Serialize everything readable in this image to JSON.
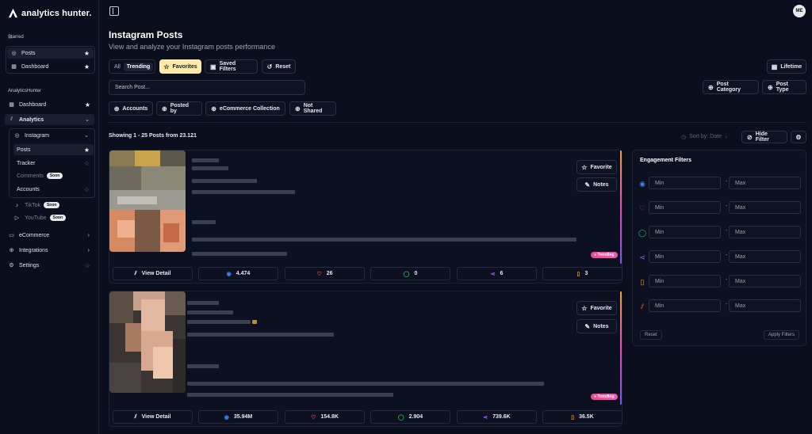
{
  "brand": {
    "name": "analytics hunter."
  },
  "sidebar": {
    "starred_label": "Starred",
    "starred": [
      {
        "label": "Posts"
      },
      {
        "label": "Dashboard"
      }
    ],
    "workspace_label": "AnalyticsHunter",
    "items": {
      "dashboard": "Dashboard",
      "analytics": "Analytics",
      "instagram": "Instagram",
      "posts": "Posts",
      "tracker": "Tracker",
      "comments": "Comments",
      "accounts": "Accounts",
      "tiktok": "TikTok",
      "youtube": "YouTube",
      "ecommerce": "eCommerce",
      "integrations": "Integrations",
      "settings": "Settings"
    },
    "soon_badge": "Soon"
  },
  "user": {
    "initials": "ME"
  },
  "page": {
    "title": "Instagram Posts",
    "subtitle": "View and analyze your Instagram posts performance"
  },
  "toolbar": {
    "seg_all": "All",
    "seg_trending": "Trending",
    "favorites": "Favorites",
    "saved_filters": "Saved Filters",
    "reset": "Reset",
    "lifetime": "Lifetime",
    "search_placeholder": "Search Post...",
    "post_category": "Post Category",
    "post_type": "Post Type",
    "accounts": "Accounts",
    "posted_by": "Posted by",
    "ecommerce_collection": "eCommerce Collection",
    "not_shared": "Not Shared"
  },
  "results": {
    "showing": "Showing 1 - 25 Posts from 23.121",
    "sort": "Sort by: Date",
    "hide_filter": "Hide Filter"
  },
  "card_actions": {
    "favorite": "Favorite",
    "notes": "Notes",
    "view_detail": "View Detail",
    "trending": "Trending"
  },
  "posts": [
    {
      "views": "4.474",
      "likes": "26",
      "comments": "0",
      "shares": "6",
      "saves": "3"
    },
    {
      "views": "35.94M",
      "likes": "154.8K",
      "comments": "2.904",
      "shares": "739.6K",
      "saves": "36.5K"
    }
  ],
  "engagement_filters": {
    "title": "Engagement Filters",
    "min_placeholder": "Min",
    "max_placeholder": "Max",
    "metrics": [
      "views",
      "likes",
      "comments",
      "shares",
      "saves",
      "growth"
    ],
    "reset": "Reset",
    "apply": "Apply Filters"
  },
  "colors": {
    "views": "#3b82f6",
    "likes": "#ef4444",
    "comments": "#22c55e",
    "shares": "#a855f7",
    "saves": "#f59e0b",
    "growth": "#f97316",
    "favorites_bg": "#fde9a8"
  }
}
